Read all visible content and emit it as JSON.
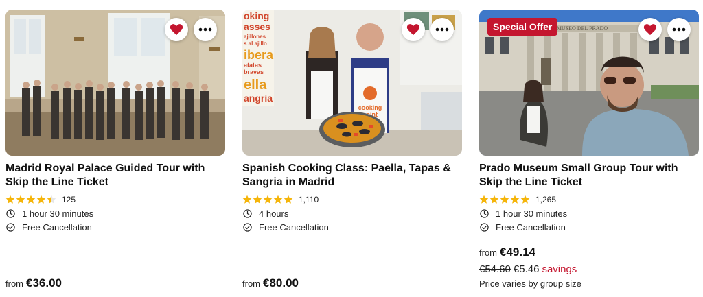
{
  "colors": {
    "heart": "#c4162f",
    "star": "#f5b50a",
    "savings": "#c4162f",
    "badge": "#c4162f"
  },
  "icons": {
    "favorite": "heart-icon",
    "more": "more-dots-icon",
    "duration": "clock-icon",
    "cancellation": "check-circle-icon",
    "rating": "star-icon"
  },
  "cards": [
    {
      "title": "Madrid Royal Palace Guided Tour with Skip the Line Ticket",
      "rating_stars": 4.5,
      "rating_count": "125",
      "duration": "1 hour 30 minutes",
      "cancellation": "Free Cancellation",
      "price_from": "from",
      "price": "€36.00"
    },
    {
      "title": "Spanish Cooking Class: Paella, Tapas & Sangria in Madrid",
      "rating_stars": 5,
      "rating_count": "1,110",
      "duration": "4 hours",
      "cancellation": "Free Cancellation",
      "price_from": "from",
      "price": "€80.00",
      "image_text": [
        "oking",
        "asses",
        "ajillones",
        "s al ajillo",
        "ibera",
        "atatas",
        "bravas",
        "ella",
        "angria",
        "cooking",
        "point"
      ]
    },
    {
      "badge": "Special Offer",
      "title": "Prado Museum Small Group Tour with Skip the Line Ticket",
      "rating_stars": 5,
      "rating_count": "1,265",
      "duration": "1 hour 30 minutes",
      "cancellation": "Free Cancellation",
      "price_from": "from",
      "price": "€49.14",
      "old_price": "€54.60",
      "savings_amount": "€5.46",
      "savings_word": "savings",
      "price_note": "Price varies by group size",
      "image_text": [
        "MUSEO DEL PRADO"
      ]
    }
  ]
}
